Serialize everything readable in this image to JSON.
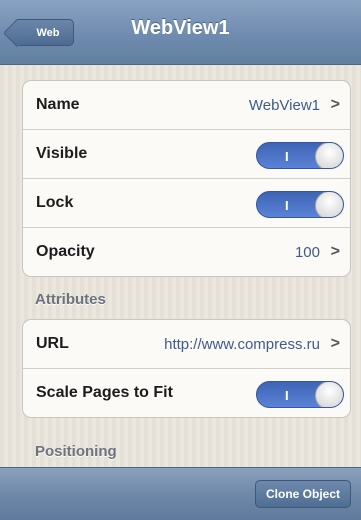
{
  "navbar": {
    "back_label": "Web",
    "title": "WebView1"
  },
  "group1": {
    "rows": [
      {
        "label": "Name",
        "value": "WebView1"
      },
      {
        "label": "Visible",
        "toggle_on": true,
        "toggle_mark": "I"
      },
      {
        "label": "Lock",
        "toggle_on": true,
        "toggle_mark": "I"
      },
      {
        "label": "Opacity",
        "value": "100"
      }
    ]
  },
  "attributes": {
    "header": "Attributes",
    "rows": [
      {
        "label": "URL",
        "value": "http://www.compress.ru"
      },
      {
        "label": "Scale Pages to Fit",
        "toggle_on": true,
        "toggle_mark": "I"
      }
    ]
  },
  "positioning": {
    "header": "Positioning"
  },
  "toolbar": {
    "clone_label": "Clone Object"
  },
  "colors": {
    "accent": "#4a72c6",
    "value_text": "#3e5b8c",
    "nav_bar": "#6f8bb0"
  },
  "icons": {
    "disclosure": "chevron-right-icon"
  }
}
